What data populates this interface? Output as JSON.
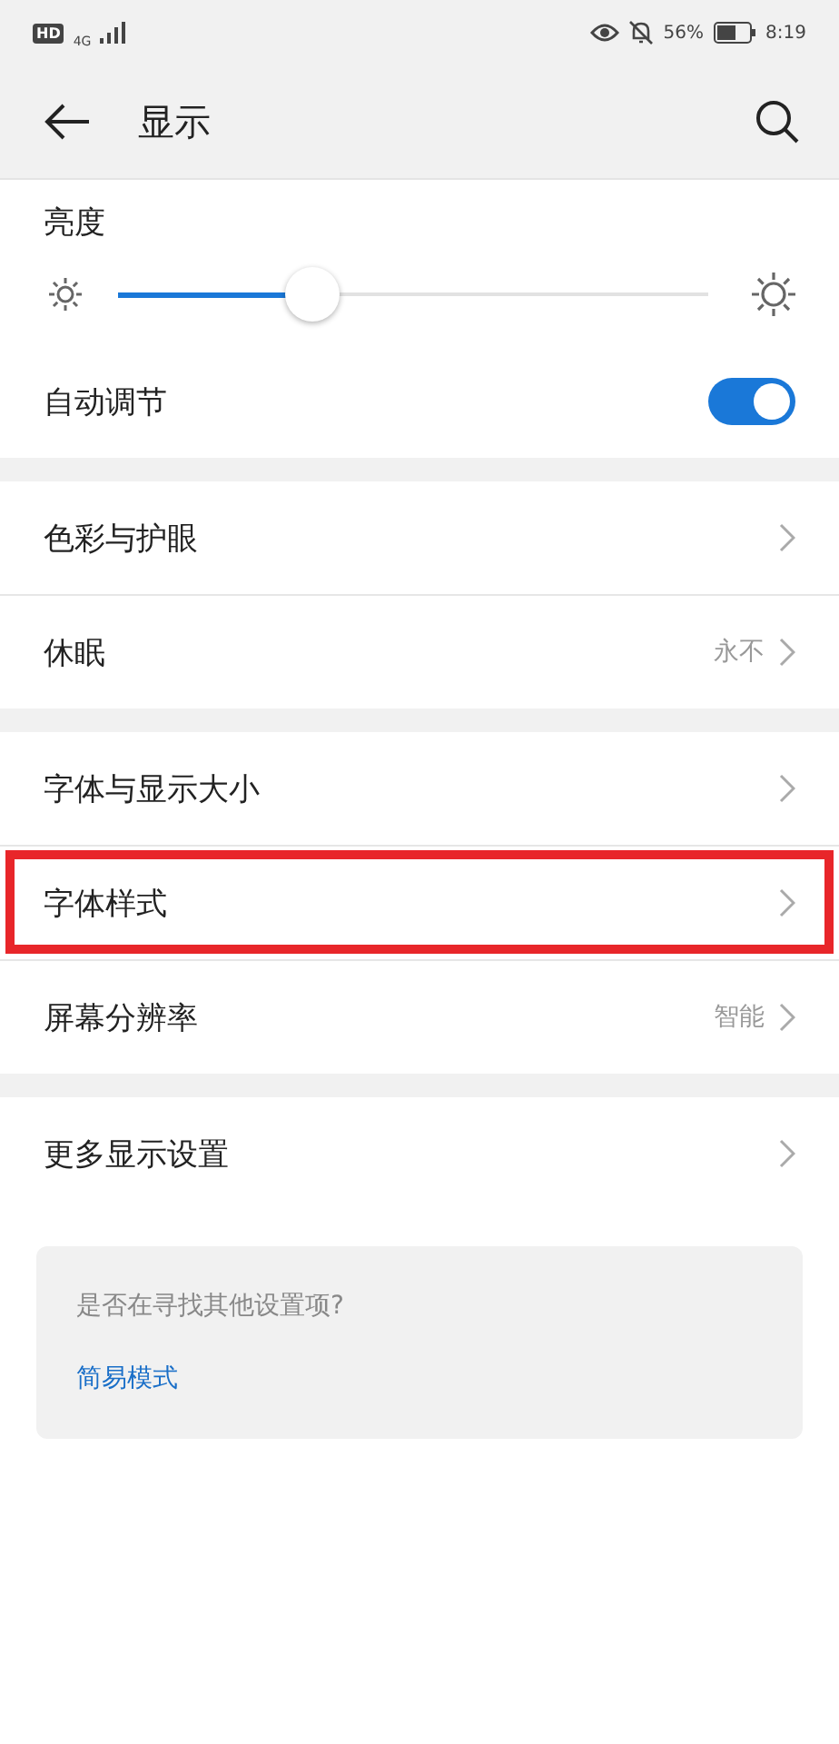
{
  "status_bar": {
    "hd": "HD",
    "network": "4G",
    "battery_percent": "56%",
    "time": "8:19"
  },
  "header": {
    "title": "显示"
  },
  "sections": [
    {
      "items": [
        {
          "kind": "slider",
          "label": "亮度",
          "level": 0.33
        },
        {
          "kind": "toggle",
          "label": "自动调节",
          "on": true
        }
      ]
    },
    {
      "items": [
        {
          "kind": "link",
          "label": "色彩与护眼",
          "highlighted": false
        },
        {
          "kind": "link",
          "label": "休眠",
          "value": "永不",
          "highlighted": false
        }
      ]
    },
    {
      "items": [
        {
          "kind": "link",
          "label": "字体与显示大小",
          "highlighted": false
        },
        {
          "kind": "link",
          "label": "字体样式",
          "highlighted": true
        },
        {
          "kind": "link",
          "label": "屏幕分辨率",
          "value": "智能",
          "highlighted": false
        }
      ]
    },
    {
      "items": [
        {
          "kind": "link",
          "label": "更多显示设置",
          "highlighted": false
        }
      ]
    }
  ],
  "suggestion_card": {
    "question": "是否在寻找其他设置项?",
    "link": "简易模式"
  }
}
